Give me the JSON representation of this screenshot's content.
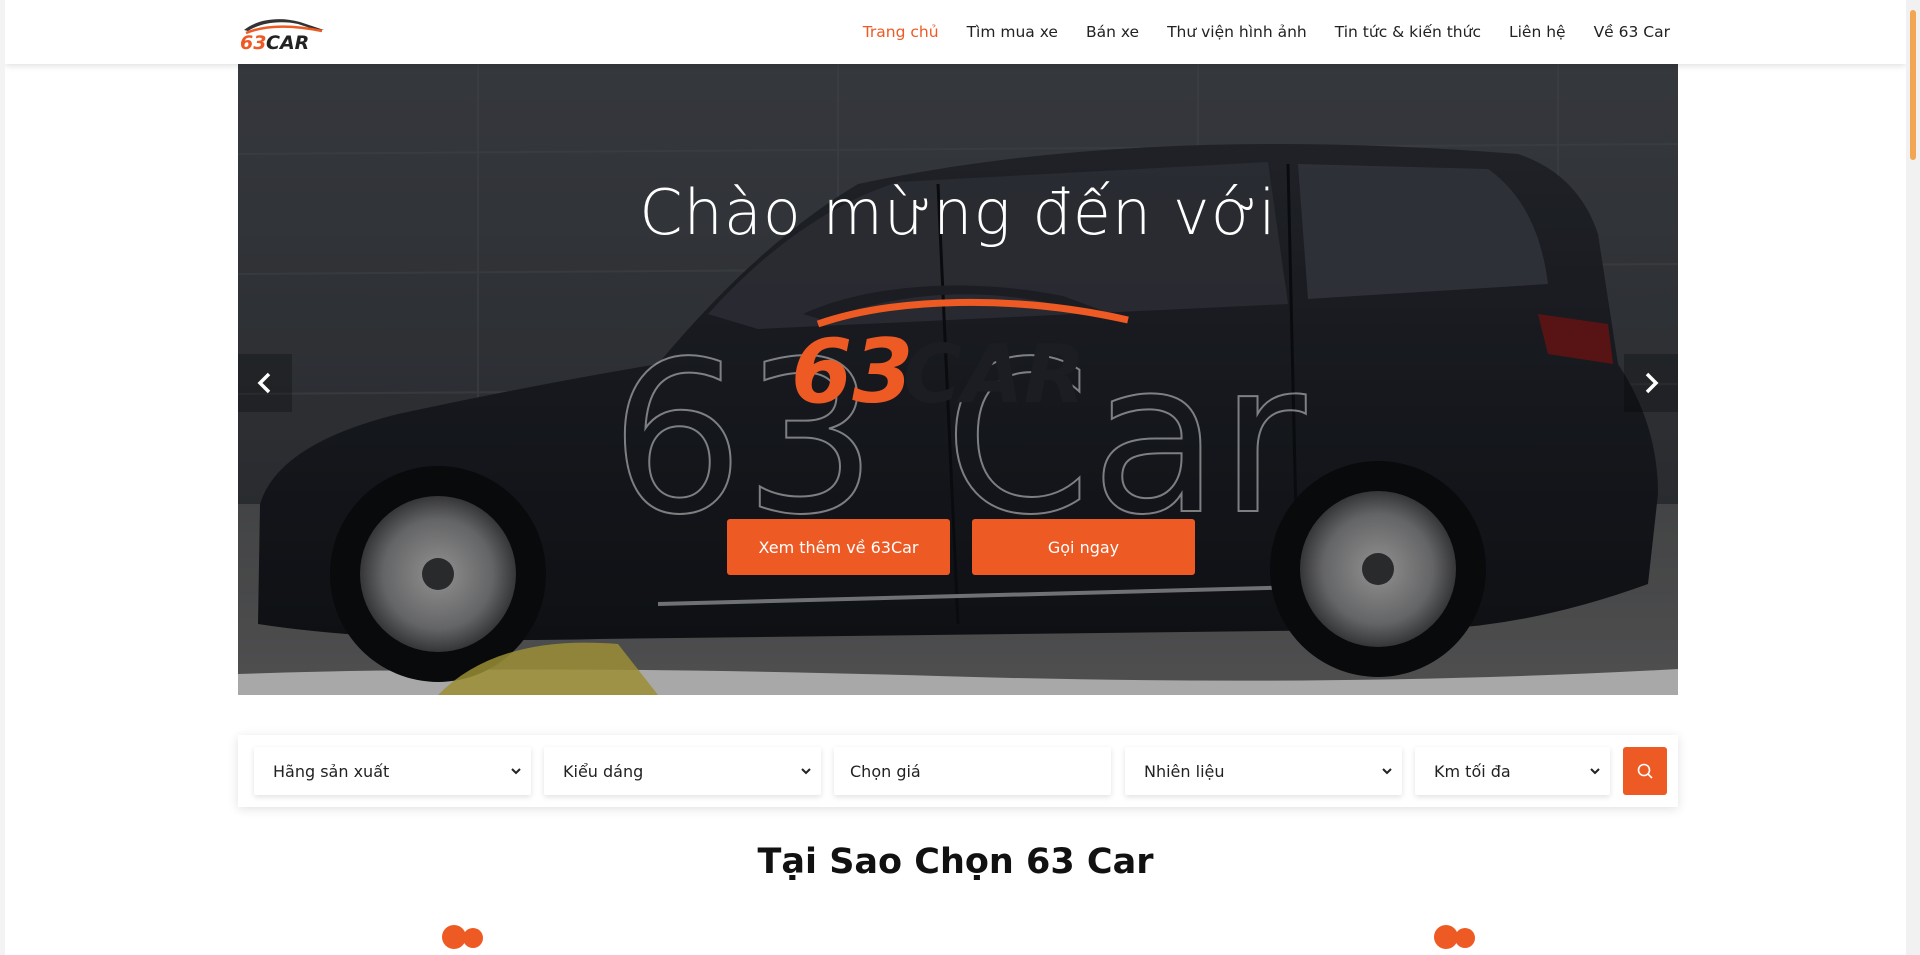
{
  "brand": {
    "name": "63CAR",
    "accent_color": "#ee5a24"
  },
  "nav": {
    "items": [
      {
        "label": "Trang chủ",
        "active": true
      },
      {
        "label": "Tìm mua xe"
      },
      {
        "label": "Bán xe"
      },
      {
        "label": "Thư viện hình ảnh"
      },
      {
        "label": "Tin tức & kiến thức"
      },
      {
        "label": "Liên hệ"
      },
      {
        "label": "Về 63 Car"
      }
    ]
  },
  "hero": {
    "title": "Chào mừng đến với",
    "outline_text": "63 Car",
    "logo_text_orange": "63",
    "logo_text_dark": "CAR",
    "primary_button": "Xem thêm về 63Car",
    "secondary_button": "Gọi ngay",
    "prev_icon": "chevron-left-icon",
    "next_icon": "chevron-right-icon"
  },
  "search": {
    "manufacturer": "Hãng sản xuất",
    "body_type": "Kiểu dáng",
    "price": "Chọn giá",
    "fuel": "Nhiên liệu",
    "max_km": "Km tối đa",
    "button_icon": "search-icon"
  },
  "why": {
    "title": "Tại Sao Chọn 63 Car"
  }
}
